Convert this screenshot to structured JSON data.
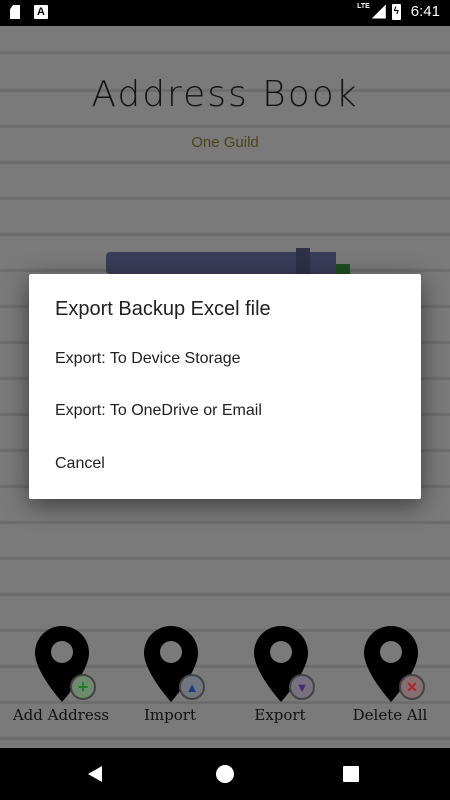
{
  "status_bar": {
    "sd_icon": "sd-card-icon",
    "a_icon_label": "A",
    "network": "LTE",
    "battery_icon": "battery-charging-icon",
    "time": "6:41"
  },
  "app": {
    "title": "Address Book",
    "subtitle": "One Guild"
  },
  "actions": [
    {
      "label": "Add Address",
      "icon": "plus-icon",
      "glyph": "+",
      "color": "#1e7d2a"
    },
    {
      "label": "Import",
      "icon": "arrow-up-icon",
      "glyph": "▲",
      "color": "#1f3a7a"
    },
    {
      "label": "Export",
      "icon": "arrow-down-icon",
      "glyph": "▼",
      "color": "#4a2a6e"
    },
    {
      "label": "Delete All",
      "icon": "close-icon",
      "glyph": "✕",
      "color": "#b01e2a"
    }
  ],
  "dialog": {
    "title": "Export Backup Excel file",
    "items": [
      "Export: To Device Storage",
      "Export: To OneDrive or Email",
      "Cancel"
    ]
  },
  "nav": {
    "back_icon": "back-icon",
    "home_icon": "home-icon",
    "recents_icon": "recents-icon"
  }
}
